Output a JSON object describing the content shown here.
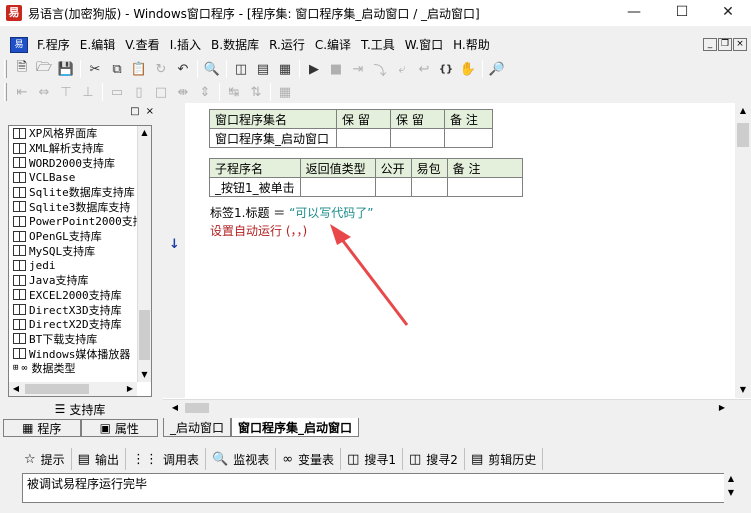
{
  "window": {
    "title": "易语言(加密狗版) - Windows窗口程序 - [程序集: 窗口程序集_启动窗口 / _启动窗口]"
  },
  "menu": {
    "items": [
      "F.程序",
      "E.编辑",
      "V.查看",
      "I.插入",
      "B.数据库",
      "R.运行",
      "C.编译",
      "T.工具",
      "W.窗口",
      "H.帮助"
    ]
  },
  "library_panel": {
    "items": [
      "XP风格界面库",
      "XML解析支持库",
      "WORD2000支持库",
      "VCLBase",
      "Sqlite数据库支持库",
      "Sqlite3数据库支持",
      "PowerPoint2000支持",
      "OPenGL支持库",
      "MySQL支持库",
      "jedi",
      "Java支持库",
      "EXCEL2000支持库",
      "DirectX3D支持库",
      "DirectX2D支持库",
      "BT下载支持库",
      "Windows媒体播放器"
    ],
    "data_types_label": "数据类型",
    "support_lib_label": "支持库",
    "tabs": [
      "程序",
      "属性"
    ]
  },
  "editor": {
    "class_table": {
      "headers": [
        "窗口程序集名",
        "保 留",
        "保 留",
        "备 注"
      ],
      "row": [
        "窗口程序集_启动窗口",
        "",
        "",
        ""
      ]
    },
    "sub_table": {
      "headers": [
        "子程序名",
        "返回值类型",
        "公开",
        "易包",
        "备 注"
      ],
      "row": [
        "_按钮1_被单击",
        "",
        "",
        "",
        ""
      ]
    },
    "code_line1_a": "标签1.标题 ＝ ",
    "code_line1_b": "“可以写代码了”",
    "code_line2": "设置自动运行 (，，)"
  },
  "code_tabs": [
    "_启动窗口",
    "窗口程序集_启动窗口"
  ],
  "bottom_tabs": [
    {
      "icon": "hint-icon",
      "label": "提示"
    },
    {
      "icon": "output-icon",
      "label": "输出"
    },
    {
      "icon": "callstack-icon",
      "label": "调用表"
    },
    {
      "icon": "watch-icon",
      "label": "监视表"
    },
    {
      "icon": "variables-icon",
      "label": "变量表"
    },
    {
      "icon": "search1-icon",
      "label": "搜寻1"
    },
    {
      "icon": "search2-icon",
      "label": "搜寻2"
    },
    {
      "icon": "clipboard-icon",
      "label": "剪辑历史"
    }
  ],
  "output": {
    "text": "被调试易程序运行完毕"
  },
  "colors": {
    "string_literal": "#1a8a8a",
    "command": "#b22222",
    "arrow": "#e8484a",
    "table_header": "#e4f0dc"
  }
}
